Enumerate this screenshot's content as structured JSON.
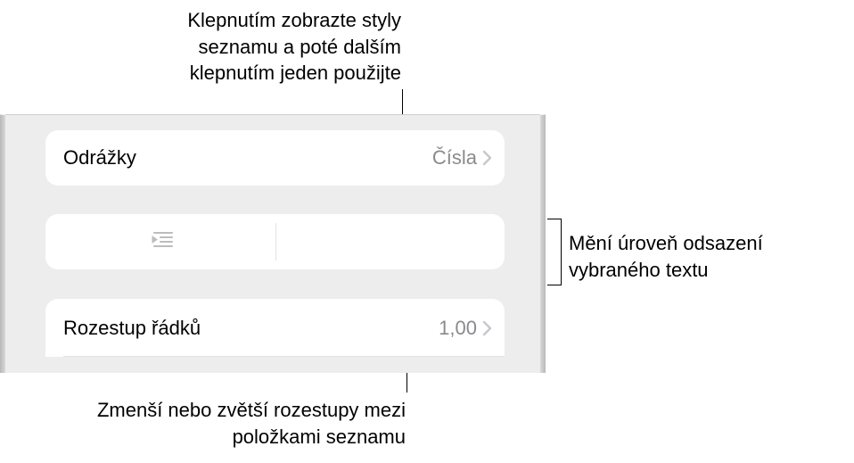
{
  "callouts": {
    "top": "Klepnutím zobrazte styly seznamu a poté dalším klepnutím jeden použijte",
    "right": "Mění úroveň odsazení vybraného textu",
    "bottom": "Zmenší nebo zvětší rozestupy mezi položkami seznamu"
  },
  "rows": {
    "bullets": {
      "label": "Odrážky",
      "value": "Čísla"
    },
    "spacing": {
      "label": "Rozestup řádků",
      "value": "1,00"
    }
  },
  "icons": {
    "outdent": "outdent-icon",
    "indent": "indent-icon",
    "chevron": "chevron-right-icon"
  }
}
